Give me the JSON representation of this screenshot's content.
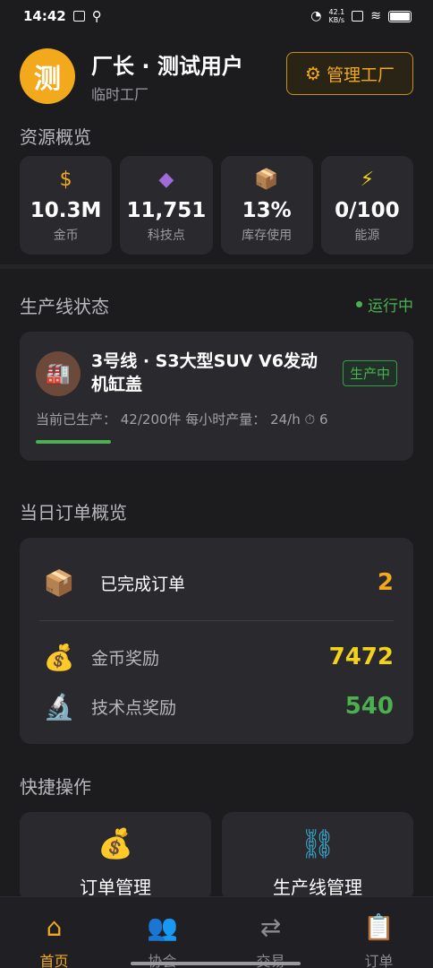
{
  "statusbar": {
    "time": "14:42",
    "net_speed": "42.1\nKB/s"
  },
  "header": {
    "avatar_char": "测",
    "title": "厂长 · 测试用户",
    "subtitle": "临时工厂",
    "manage_label": "管理工厂"
  },
  "resources": {
    "section_title": "资源概览",
    "items": [
      {
        "icon": "dollar-icon",
        "glyph": "$",
        "value": "10.3M",
        "label": "金币",
        "color": "#f2a91b"
      },
      {
        "icon": "diamond-icon",
        "glyph": "◆",
        "value": "11,751",
        "label": "科技点",
        "color": "#a06bd6"
      },
      {
        "icon": "box-icon",
        "glyph": "📦",
        "value": "13%",
        "label": "库存使用",
        "color": "#f2a91b"
      },
      {
        "icon": "lightning-icon",
        "glyph": "⚡",
        "value": "0/100",
        "label": "能源",
        "color": "#f2d21b"
      }
    ]
  },
  "production": {
    "section_title": "生产线状态",
    "status": "运行中",
    "line_name": "3号线 · S3大型SUV V6发动机缸盖",
    "badge": "生产中",
    "stats": "当前已生产： 42/200件   每小时产量：  24/h  ⏱ 6",
    "progress": 0.21
  },
  "orders": {
    "section_title": "当日订单概览",
    "completed_label": "已完成订单",
    "completed_value": "2",
    "gold_label": "金币奖励",
    "gold_value": "7472",
    "tech_label": "技术点奖励",
    "tech_value": "540",
    "colors": {
      "completed": "#f2a91b",
      "gold": "#f2d21b",
      "tech": "#4caf50"
    }
  },
  "quick": {
    "section_title": "快捷操作",
    "items": [
      {
        "icon": "money-bag-icon",
        "label": "订单管理"
      },
      {
        "icon": "chain-icon",
        "label": "生产线管理"
      }
    ]
  },
  "tabs": [
    {
      "icon": "home-icon",
      "label": "首页",
      "active": true
    },
    {
      "icon": "people-icon",
      "label": "协会",
      "active": false
    },
    {
      "icon": "exchange-icon",
      "label": "交易",
      "active": false
    },
    {
      "icon": "clipboard-icon",
      "label": "订单",
      "active": false
    }
  ]
}
